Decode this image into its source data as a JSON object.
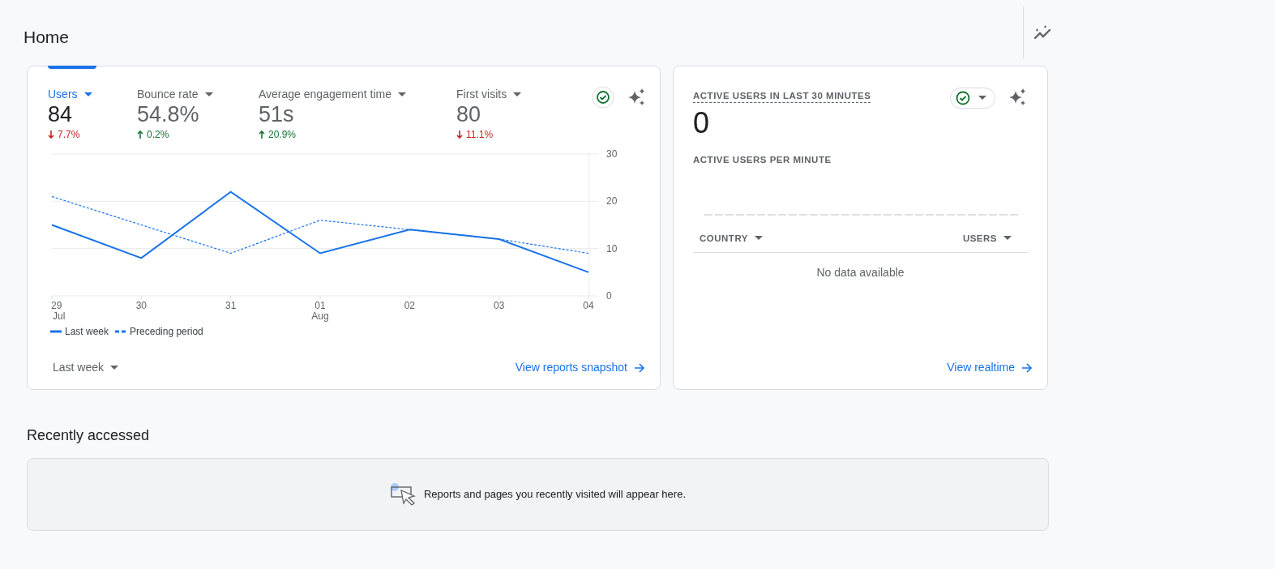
{
  "page": {
    "title": "Home"
  },
  "overview": {
    "metrics": [
      {
        "label": "Users",
        "value": "84",
        "change": "7.7%",
        "kind": "decrease",
        "selected": true
      },
      {
        "label": "Bounce rate",
        "value": "54.8%",
        "change": "0.2%",
        "kind": "increase",
        "selected": false
      },
      {
        "label": "Average engagement time",
        "value": "51s",
        "change": "20.9%",
        "kind": "increase",
        "selected": false
      },
      {
        "label": "First visits",
        "value": "80",
        "change": "11.1%",
        "kind": "decrease",
        "selected": false
      }
    ],
    "chart_data": {
      "type": "line",
      "categories": [
        "29 Jul",
        "30",
        "31",
        "01 Aug",
        "02",
        "03",
        "04"
      ],
      "ylim": [
        0,
        30
      ],
      "yticks": [
        0,
        10,
        20,
        30
      ],
      "series": [
        {
          "name": "Last week",
          "color": "#1a73e8",
          "line_style": "solid",
          "values": [
            15,
            8,
            22,
            9,
            14,
            12,
            5
          ]
        },
        {
          "name": "Preceding period",
          "color": "#1a73e8",
          "line_style": "dashed",
          "values": [
            21,
            15,
            9,
            16,
            14,
            12,
            9
          ]
        }
      ]
    },
    "period": "Last week",
    "link": "View reports snapshot"
  },
  "realtime": {
    "title": "ACTIVE USERS IN LAST 30 MINUTES",
    "value": "0",
    "subtitle": "ACTIVE USERS PER MINUTE",
    "columns": [
      "COUNTRY",
      "USERS"
    ],
    "empty": "No data available",
    "link": "View realtime"
  },
  "recent": {
    "title": "Recently accessed",
    "message": "Reports and pages you recently visited will appear here."
  }
}
